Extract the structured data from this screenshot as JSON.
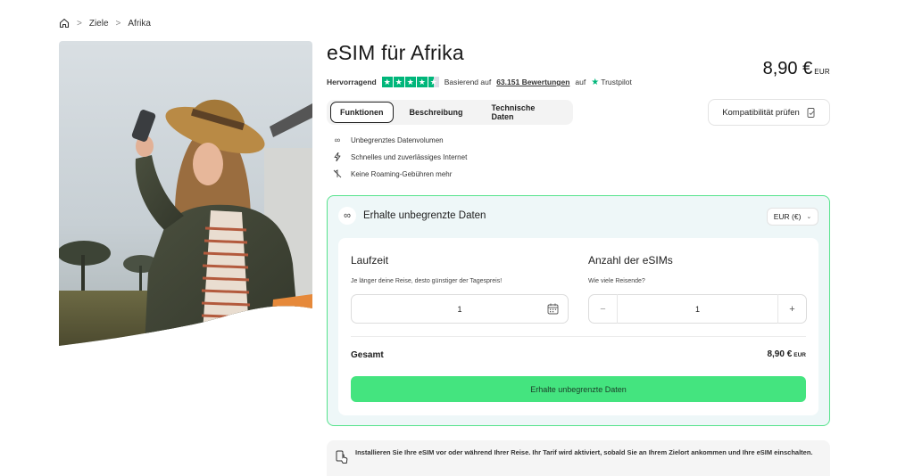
{
  "breadcrumb": {
    "items": [
      "Ziele",
      "Afrika"
    ],
    "separator": ">"
  },
  "product": {
    "title": "eSIM für Afrika",
    "price_value": "8,90 €",
    "price_currency": "EUR"
  },
  "rating": {
    "label": "Hervorragend",
    "stars": 4.5,
    "based_on": "Basierend auf",
    "reviews_link": "63.151 Bewertungen",
    "on": "auf",
    "provider": "Trustpilot"
  },
  "tabs": [
    {
      "label": "Funktionen",
      "active": true
    },
    {
      "label": "Beschreibung",
      "active": false
    },
    {
      "label": "Technische Daten",
      "active": false
    }
  ],
  "compat_button": "Kompatibilität prüfen",
  "features": [
    {
      "icon": "infinity-icon",
      "text": "Unbegrenztes Datenvolumen"
    },
    {
      "icon": "lightning-icon",
      "text": "Schnelles und zuverlässiges Internet"
    },
    {
      "icon": "no-roaming-icon",
      "text": "Keine Roaming-Gebühren mehr"
    }
  ],
  "plan": {
    "heading": "Erhalte unbegrenzte Daten",
    "currency_select": "EUR (€)",
    "duration": {
      "title": "Laufzeit",
      "subtitle": "Je länger deine Reise, desto günstiger der Tagespreis!",
      "value": "1"
    },
    "esims": {
      "title": "Anzahl der eSIMs",
      "subtitle": "Wie viele Reisende?",
      "value": "1",
      "minus": "−",
      "plus": "+"
    },
    "total_label": "Gesamt",
    "total_value": "8,90 €",
    "total_currency": "EUR",
    "cta": "Erhalte unbegrenzte Daten"
  },
  "notice": {
    "text": "Installieren Sie Ihre eSIM vor oder während Ihrer Reise. Ihr Tarif wird aktiviert, sobald Sie an Ihrem Zielort ankommen und Ihre eSIM einschalten."
  },
  "colors": {
    "accent_green": "#44e47f",
    "trustpilot_green": "#00b67a",
    "plan_border": "#56e38c",
    "plan_bg": "#eef7f8"
  }
}
